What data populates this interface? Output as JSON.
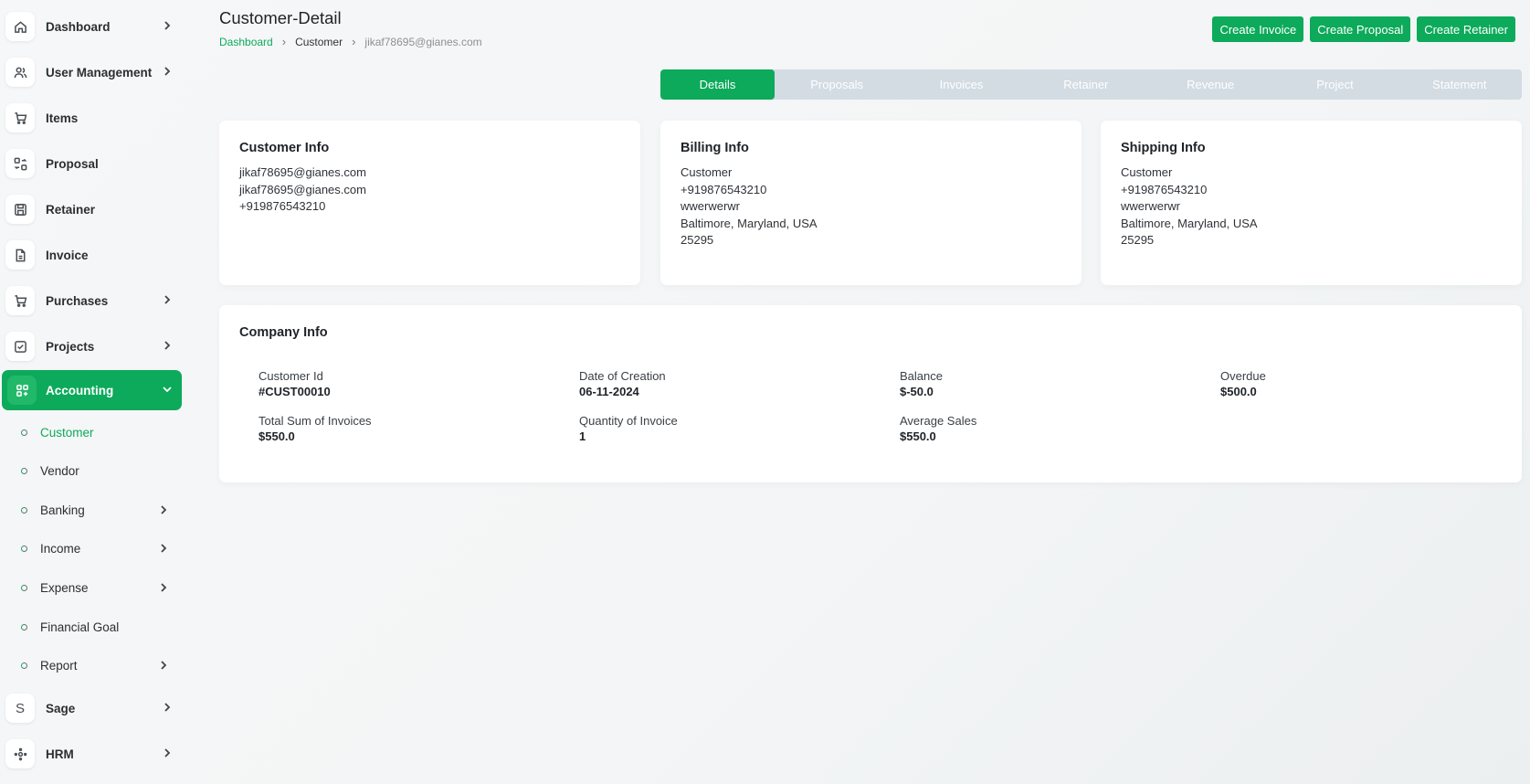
{
  "page": {
    "title": "Customer-Detail",
    "breadcrumb": {
      "root": "Dashboard",
      "parent": "Customer",
      "current": "jikaf78695@gianes.com"
    }
  },
  "actions": {
    "create_invoice": "Create Invoice",
    "create_proposal": "Create Proposal",
    "create_retainer": "Create Retainer"
  },
  "sidebar": {
    "items": [
      {
        "label": "Dashboard",
        "icon": "home-icon",
        "chevron": true
      },
      {
        "label": "User Management",
        "icon": "users-icon",
        "chevron": true
      },
      {
        "label": "Items",
        "icon": "cart-icon",
        "chevron": false
      },
      {
        "label": "Proposal",
        "icon": "swap-icon",
        "chevron": false
      },
      {
        "label": "Retainer",
        "icon": "save-icon",
        "chevron": false
      },
      {
        "label": "Invoice",
        "icon": "file-icon",
        "chevron": false
      },
      {
        "label": "Purchases",
        "icon": "cart-icon",
        "chevron": true
      },
      {
        "label": "Projects",
        "icon": "checkbox-icon",
        "chevron": true
      },
      {
        "label": "Accounting",
        "icon": "grid-icon",
        "chevron": true
      }
    ],
    "accounting_sub": [
      {
        "label": "Customer",
        "chevron": false
      },
      {
        "label": "Vendor",
        "chevron": false
      },
      {
        "label": "Banking",
        "chevron": true
      },
      {
        "label": "Income",
        "chevron": true
      },
      {
        "label": "Expense",
        "chevron": true
      },
      {
        "label": "Financial Goal",
        "chevron": false
      },
      {
        "label": "Report",
        "chevron": true
      }
    ],
    "bottom": [
      {
        "label": "Sage",
        "icon": "s-letter-icon",
        "icon_text": "S"
      },
      {
        "label": "HRM",
        "icon": "network-icon"
      }
    ]
  },
  "tabs": [
    "Details",
    "Proposals",
    "Invoices",
    "Retainer",
    "Revenue",
    "Project",
    "Statement"
  ],
  "customer_info": {
    "title": "Customer Info",
    "lines": [
      "jikaf78695@gianes.com",
      "jikaf78695@gianes.com",
      "+919876543210"
    ]
  },
  "billing_info": {
    "title": "Billing Info",
    "lines": [
      "Customer",
      "+919876543210",
      "wwerwerwr",
      "Baltimore, Maryland, USA",
      "25295"
    ]
  },
  "shipping_info": {
    "title": "Shipping Info",
    "lines": [
      "Customer",
      "+919876543210",
      "wwerwerwr",
      "Baltimore, Maryland, USA",
      "25295"
    ]
  },
  "company_info": {
    "title": "Company Info",
    "fields": [
      {
        "label": "Customer Id",
        "value": "#CUST00010"
      },
      {
        "label": "Date of Creation",
        "value": "06-11-2024"
      },
      {
        "label": "Balance",
        "value": "$-50.0"
      },
      {
        "label": "Overdue",
        "value": "$500.0"
      },
      {
        "label": "Total Sum of Invoices",
        "value": "$550.0"
      },
      {
        "label": "Quantity of Invoice",
        "value": "1"
      },
      {
        "label": "Average Sales",
        "value": "$550.0"
      }
    ]
  },
  "colors": {
    "accent": "#0caa5a",
    "tab_inactive": "#d3dce3"
  }
}
